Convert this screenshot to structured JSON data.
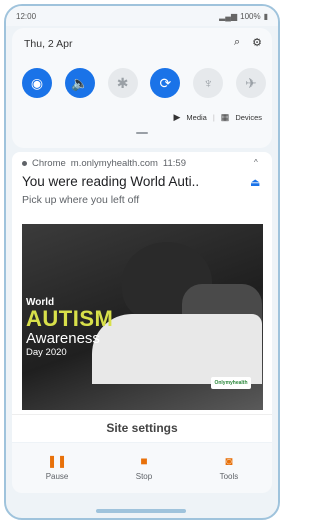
{
  "status_bar": {
    "time": "12:00",
    "battery": "100%"
  },
  "quick_settings": {
    "date": "Thu, 2 Apr",
    "top_icons": [
      "search-icon",
      "gear-icon"
    ],
    "tiles": [
      {
        "name": "wifi",
        "icon": "wifi-icon",
        "on": true
      },
      {
        "name": "sound",
        "icon": "speaker-icon",
        "on": true
      },
      {
        "name": "bluetooth",
        "icon": "bluetooth-icon",
        "on": false
      },
      {
        "name": "auto-rotate",
        "icon": "rotate-icon",
        "on": true
      },
      {
        "name": "flashlight",
        "icon": "flashlight-icon",
        "on": false
      },
      {
        "name": "airplane",
        "icon": "airplane-icon",
        "on": false
      }
    ],
    "media_label": "Media",
    "devices_label": "Devices"
  },
  "notification": {
    "app": "Chrome",
    "domain": "m.onlymyhealth.com",
    "time": "11:59",
    "title": "You were reading World Auti..",
    "subtitle": "Pick up where you left off",
    "banner": {
      "line1": "World",
      "line2": "AUTISM",
      "line3": "Awareness",
      "line4": "Day 2020",
      "logo": "Onlymyhealth"
    },
    "site_settings": "Site settings"
  },
  "actions": [
    {
      "label": "Pause",
      "icon": "pause-icon"
    },
    {
      "label": "Stop",
      "icon": "stop-icon"
    },
    {
      "label": "Tools",
      "icon": "camera-icon"
    }
  ],
  "colors": {
    "accent": "#1a73e8",
    "action_orange": "#e8710a",
    "frame": "#9fc3dc"
  }
}
